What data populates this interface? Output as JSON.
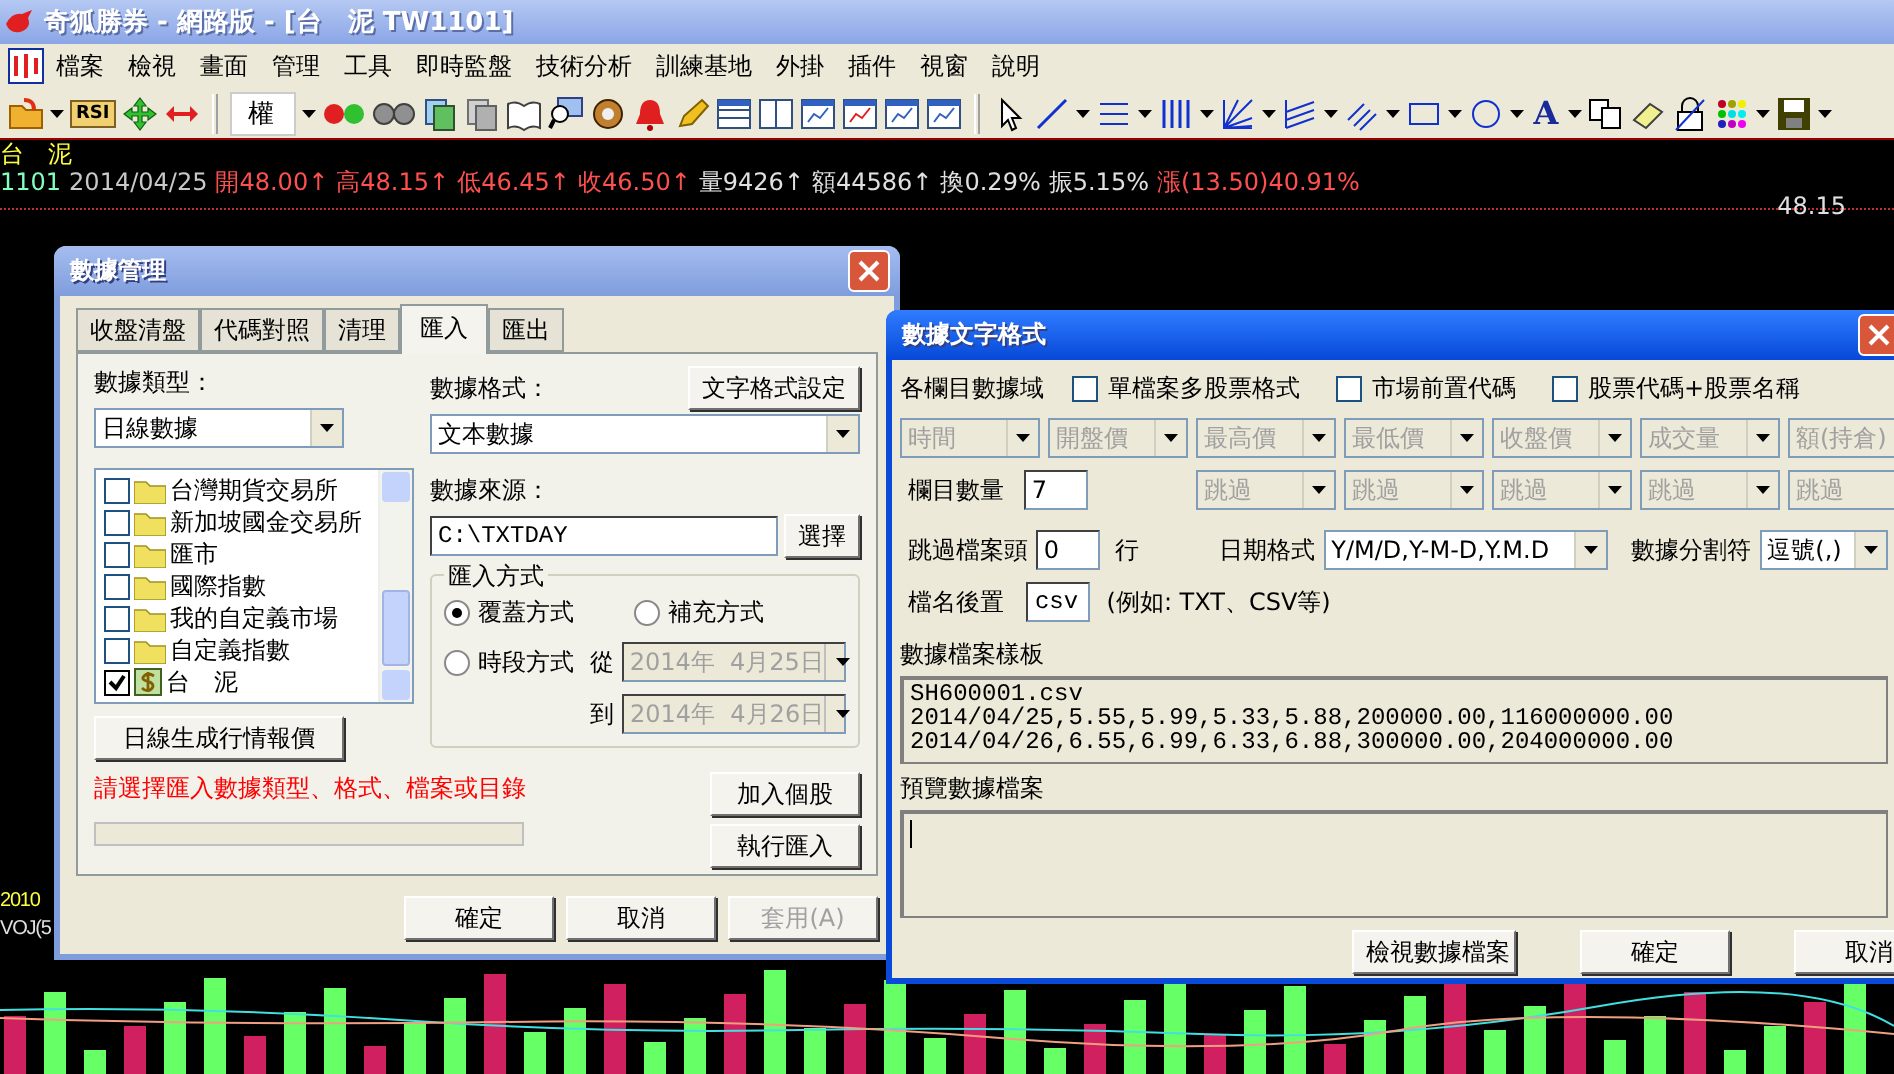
{
  "window": {
    "title": "奇狐勝券 - 網路版 - [台　泥 TW1101]"
  },
  "menu": [
    "檔案",
    "檢視",
    "畫面",
    "管理",
    "工具",
    "即時監盤",
    "技術分析",
    "訓練基地",
    "外掛",
    "插件",
    "視窗",
    "說明"
  ],
  "toolbar": {
    "rsi_label": "RSI",
    "rights_label": "權",
    "text_tool_label": "A"
  },
  "quote": {
    "name": "台　泥",
    "code": "1101",
    "date": "2014/04/25",
    "price_label": "48.15",
    "fields": [
      {
        "text": "開48.00↑",
        "color": "#ff5050"
      },
      {
        "text": "高48.15↑",
        "color": "#ff5050"
      },
      {
        "text": "低46.45↑",
        "color": "#ff5050"
      },
      {
        "text": "收46.50↑",
        "color": "#ff5050"
      },
      {
        "text": "量9426↑",
        "color": "#e0e0e0"
      },
      {
        "text": "額44586↑",
        "color": "#e0e0e0"
      },
      {
        "text": "換0.29%",
        "color": "#e0e0e0"
      },
      {
        "text": "振5.15%",
        "color": "#e0e0e0"
      },
      {
        "text": "漲(13.50)40.91%",
        "color": "#ff5050"
      }
    ]
  },
  "chart_labels": [
    "2010",
    "VOJ(5"
  ],
  "data_manager": {
    "title": "數據管理",
    "tabs": [
      {
        "label": "收盤清盤",
        "selected": false
      },
      {
        "label": "代碼對照",
        "selected": false
      },
      {
        "label": "清理",
        "selected": false
      },
      {
        "label": "匯入",
        "selected": true
      },
      {
        "label": "匯出",
        "selected": false
      }
    ],
    "type_label": "數據類型：",
    "type_value": "日線數據",
    "format_label": "數據格式：",
    "format_button": "文字格式設定",
    "format_value": "文本數據",
    "markets": [
      {
        "label": "台灣期貨交易所",
        "kind": "folder",
        "checked": false
      },
      {
        "label": "新加坡國金交易所",
        "kind": "folder",
        "checked": false
      },
      {
        "label": "匯市",
        "kind": "folder",
        "checked": false
      },
      {
        "label": "國際指數",
        "kind": "folder",
        "checked": false
      },
      {
        "label": "我的自定義市場",
        "kind": "folder",
        "checked": false
      },
      {
        "label": "自定義指數",
        "kind": "folder",
        "checked": false
      },
      {
        "label": "台　泥",
        "kind": "stock",
        "checked": true
      }
    ],
    "generate_button": "日線生成行情報價",
    "source_label": "數據來源：",
    "source_value": "C:\\TXTDAY",
    "browse_button": "選擇",
    "mode_legend": "匯入方式",
    "modes": [
      {
        "label": "覆蓋方式",
        "selected": true
      },
      {
        "label": "補充方式",
        "selected": false
      },
      {
        "label": "時段方式",
        "selected": false
      }
    ],
    "from_label": "從",
    "from_value": "2014年  4月25日",
    "to_label": "到",
    "to_value": "2014年  4月26日",
    "dates_disabled": true,
    "message": "請選擇匯入數據類型、格式、檔案或目錄",
    "progress": {
      "level": 0
    },
    "side_buttons": [
      "加入個股",
      "執行匯入"
    ],
    "footer_buttons": [
      {
        "label": "確定",
        "disabled": false
      },
      {
        "label": "取消",
        "disabled": false
      },
      {
        "label": "套用(A)",
        "disabled": true
      }
    ]
  },
  "text_format": {
    "title": "數據文字格式",
    "fields_label": "各欄目數據域",
    "options": [
      {
        "label": "單檔案多股票格式",
        "checked": false
      },
      {
        "label": "市場前置代碼",
        "checked": false
      },
      {
        "label": "股票代碼+股票名稱",
        "checked": false
      }
    ],
    "columns": [
      {
        "label": "時間",
        "disabled": true
      },
      {
        "label": "開盤價",
        "disabled": true
      },
      {
        "label": "最高價",
        "disabled": true
      },
      {
        "label": "最低價",
        "disabled": true
      },
      {
        "label": "收盤價",
        "disabled": true
      },
      {
        "label": "成交量",
        "disabled": true
      },
      {
        "label": "額(持倉)",
        "disabled": true
      }
    ],
    "count_label": "欄目數量",
    "count_value": "7",
    "extra_columns": [
      {
        "label": "跳過",
        "disabled": true
      },
      {
        "label": "跳過",
        "disabled": true
      },
      {
        "label": "跳過",
        "disabled": true
      },
      {
        "label": "跳過",
        "disabled": true
      },
      {
        "label": "跳過",
        "disabled": true
      }
    ],
    "skip_label": "跳過檔案頭",
    "skip_value": "0",
    "skip_unit": "行",
    "date_label": "日期格式",
    "date_value": "Y/M/D,Y-M-D,Y.M.D",
    "sep_label": "數據分割符",
    "sep_value": "逗號(,)",
    "ext_label": "檔名後置",
    "ext_value": "csv",
    "ext_hint": "(例如: TXT、CSV等)",
    "template_label": "數據檔案樣板",
    "template_lines": [
      "SH600001.csv",
      "2014/04/25,5.55,5.99,5.33,5.88,200000.00,116000000.00",
      "2014/04/26,6.55,6.99,6.33,6.88,300000.00,204000000.00"
    ],
    "preview_label": "預覽數據檔案",
    "buttons": [
      "檢視數據檔案",
      "確定",
      "取消"
    ]
  }
}
